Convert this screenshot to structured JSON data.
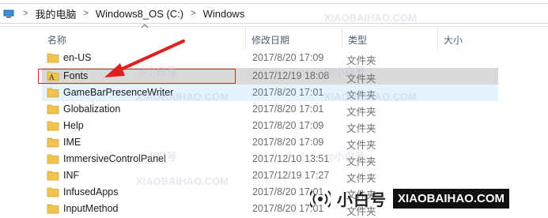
{
  "address": {
    "crumbs": [
      "我的电脑",
      "Windows8_OS (C:)",
      "Windows"
    ],
    "separator": ">"
  },
  "columns": {
    "name": "名称",
    "date": "修改日期",
    "type": "类型",
    "size": "大小"
  },
  "rows": [
    {
      "name": "en-US",
      "date": "2017/8/20 17:09",
      "type": "文件夹",
      "icon": "folder-icon"
    },
    {
      "name": "Fonts",
      "date": "2017/12/19 18:08",
      "type": "文件夹",
      "icon": "fonts-folder-icon"
    },
    {
      "name": "GameBarPresenceWriter",
      "date": "2017/8/20 17:01",
      "type": "文件夹",
      "icon": "folder-icon"
    },
    {
      "name": "Globalization",
      "date": "2017/8/20 17:01",
      "type": "文件夹",
      "icon": "folder-icon"
    },
    {
      "name": "Help",
      "date": "2017/8/20 17:09",
      "type": "文件夹",
      "icon": "folder-icon"
    },
    {
      "name": "IME",
      "date": "2017/8/20 17:09",
      "type": "文件夹",
      "icon": "folder-icon"
    },
    {
      "name": "ImmersiveControlPanel",
      "date": "2017/12/10 13:51",
      "type": "文件夹",
      "icon": "folder-icon"
    },
    {
      "name": "INF",
      "date": "2017/12/19 17:27",
      "type": "文件夹",
      "icon": "folder-icon"
    },
    {
      "name": "InfusedApps",
      "date": "2017/8/20 17:01",
      "type": "文件夹",
      "icon": "folder-icon"
    },
    {
      "name": "InputMethod",
      "date": "2017/8/20 17:01",
      "type": "文件夹",
      "icon": "folder-icon"
    }
  ],
  "watermark": {
    "brand_cn": "小白号",
    "brand_en": "XIAOBAIHAO.COM",
    "tile_cn": "@小白号",
    "tile_en": "XIAOBAIHAO.COM"
  },
  "colors": {
    "highlight_border": "#e02020",
    "arrow": "#e02020",
    "selected_gray": "#d9d9d9",
    "hover_blue": "#e5f3ff",
    "folder": "#f0c450"
  }
}
